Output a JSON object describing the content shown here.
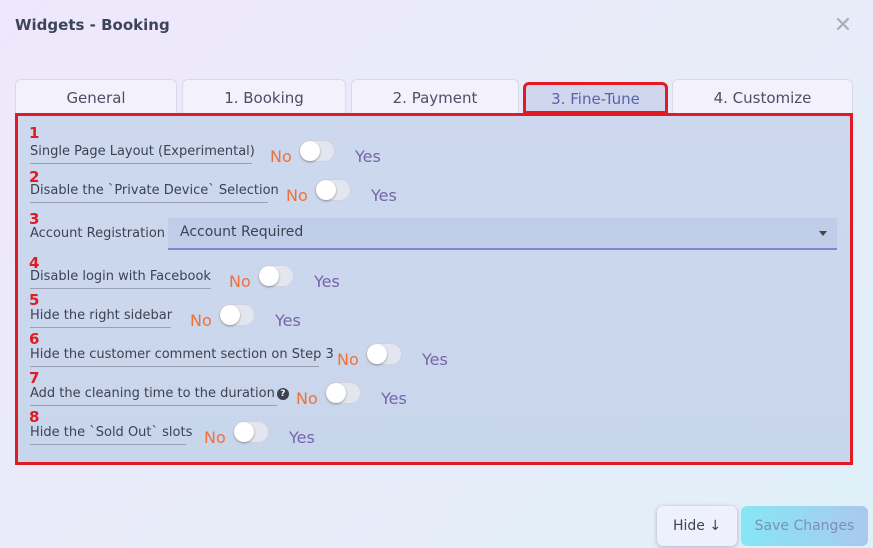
{
  "window": {
    "title": "Widgets - Booking",
    "close_icon": "close-icon"
  },
  "tabs": [
    {
      "label": "General"
    },
    {
      "label": "1. Booking"
    },
    {
      "label": "2. Payment"
    },
    {
      "label": "3. Fine-Tune",
      "active": true
    },
    {
      "label": "4. Customize"
    }
  ],
  "settings": {
    "no_label": "No",
    "yes_label": "Yes",
    "items": [
      {
        "number": "1",
        "label": "Single Page Layout (Experimental)",
        "value": "No"
      },
      {
        "number": "2",
        "label": "Disable the `Private Device` Selection",
        "value": "No"
      },
      {
        "number": "3",
        "label": "Account Registration",
        "value": "Account Required"
      },
      {
        "number": "4",
        "label": "Disable login with Facebook",
        "value": "No"
      },
      {
        "number": "5",
        "label": "Hide the right sidebar",
        "value": "No"
      },
      {
        "number": "6",
        "label": "Hide the customer comment section on Step 3",
        "value": "No"
      },
      {
        "number": "7",
        "label": "Add the cleaning time to the duration",
        "value": "No",
        "help_icon": "question-circle-icon"
      },
      {
        "number": "8",
        "label": "Hide the `Sold Out` slots",
        "value": "No"
      }
    ]
  },
  "footer": {
    "hide_label": "Hide",
    "hide_icon": "↓",
    "save_label": "Save Changes"
  },
  "colors": {
    "annotation": "#e01b24",
    "no": "#f0703a",
    "yes": "#7665a8",
    "accent": "#8a82c8"
  }
}
